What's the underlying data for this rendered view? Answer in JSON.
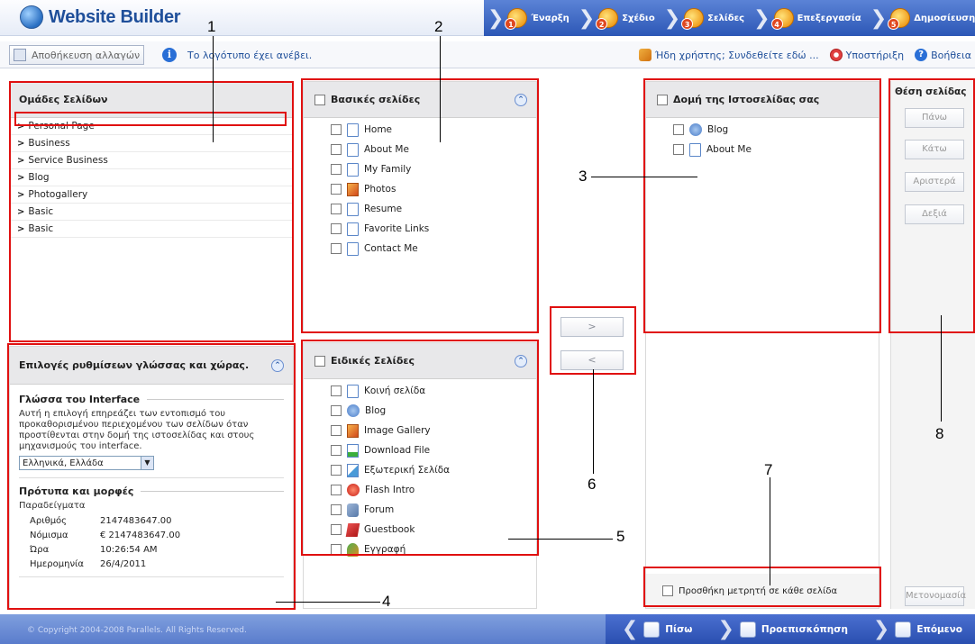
{
  "app": {
    "title": "Website Builder"
  },
  "steps": [
    {
      "num": "1",
      "label": "Έναρξη"
    },
    {
      "num": "2",
      "label": "Σχέδιο"
    },
    {
      "num": "3",
      "label": "Σελίδες"
    },
    {
      "num": "4",
      "label": "Επεξεργασία"
    },
    {
      "num": "5",
      "label": "Δημοσίευση"
    }
  ],
  "toolbar": {
    "save_label": "Αποθήκευση αλλαγών",
    "info_message": "Το λογότυπο έχει ανέβει.",
    "login_link": "Ήδη χρήστης; Συνδεθείτε εδώ ...",
    "support_link": "Υποστήριξη",
    "help_link": "Βοήθεια"
  },
  "page_groups": {
    "title": "Ομάδες Σελίδων",
    "items": [
      "Personal Page",
      "Business",
      "Service Business",
      "Blog",
      "Photogallery",
      "Basic",
      "Basic"
    ]
  },
  "basic_pages": {
    "title": "Βασικές σελίδες",
    "items": [
      {
        "label": "Home",
        "icon": "page-icon"
      },
      {
        "label": "About Me",
        "icon": "page-icon"
      },
      {
        "label": "My Family",
        "icon": "page-icon"
      },
      {
        "label": "Photos",
        "icon": "photo-icon"
      },
      {
        "label": "Resume",
        "icon": "page-icon"
      },
      {
        "label": "Favorite Links",
        "icon": "page-icon"
      },
      {
        "label": "Contact Me",
        "icon": "page-icon"
      }
    ]
  },
  "special_pages": {
    "title": "Ειδικές Σελίδες",
    "items": [
      {
        "label": "Κοινή σελίδα",
        "icon": "page-icon"
      },
      {
        "label": "Blog",
        "icon": "blog-icon"
      },
      {
        "label": "Image Gallery",
        "icon": "photo-icon"
      },
      {
        "label": "Download File",
        "icon": "download-icon"
      },
      {
        "label": "Εξωτερική Σελίδα",
        "icon": "external-page-icon"
      },
      {
        "label": "Flash Intro",
        "icon": "flash-icon"
      },
      {
        "label": "Forum",
        "icon": "forum-icon"
      },
      {
        "label": "Guestbook",
        "icon": "guestbook-icon"
      },
      {
        "label": "Εγγραφή",
        "icon": "register-icon"
      }
    ]
  },
  "transfer": {
    "add_label": ">",
    "remove_label": "<"
  },
  "site_structure": {
    "title": "Δομή της Ιστοσελίδας σας",
    "items": [
      {
        "label": "Blog",
        "icon": "blog-icon"
      },
      {
        "label": "About Me",
        "icon": "page-icon"
      }
    ],
    "counter_label": "Προσθήκη μετρητή σε κάθε σελίδα"
  },
  "page_position": {
    "title": "Θέση σελίδας",
    "up": "Πάνω",
    "down": "Κάτω",
    "left": "Αριστερά",
    "right": "Δεξιά",
    "rename": "Μετονομασία"
  },
  "language": {
    "title": "Επιλογές ρυθμίσεων γλώσσας και χώρας.",
    "interface_heading": "Γλώσσα του Interface",
    "interface_desc": "Αυτή η επιλογή επηρεάζει των εντοπισμό του προκαθορισμένου περιεχομένου των σελίδων όταν προστίθενται στην δομή της ιστοσελίδας και στους μηχανισμούς του interface.",
    "selected_language": "Ελληνικά, Ελλάδα",
    "formats_heading": "Πρότυπα και μορφές",
    "examples_label": "Παραδείγματα",
    "formats": [
      {
        "k": "Αριθμός",
        "v": "2147483647.00"
      },
      {
        "k": "Νόμισμα",
        "v": "€ 2147483647.00"
      },
      {
        "k": "Ώρα",
        "v": "10:26:54 AM"
      },
      {
        "k": "Ημερομηνία",
        "v": "26/4/2011"
      }
    ]
  },
  "annotations": [
    "1",
    "2",
    "3",
    "4",
    "5",
    "6",
    "7",
    "8"
  ],
  "footer": {
    "copyright": "© Copyright 2004-2008 Parallels. All Rights Reserved.",
    "back": "Πίσω",
    "preview": "Προεπισκόπηση",
    "next": "Επόμενο"
  },
  "colors": {
    "accent": "#2c57b6",
    "highlight": "#e01010"
  }
}
